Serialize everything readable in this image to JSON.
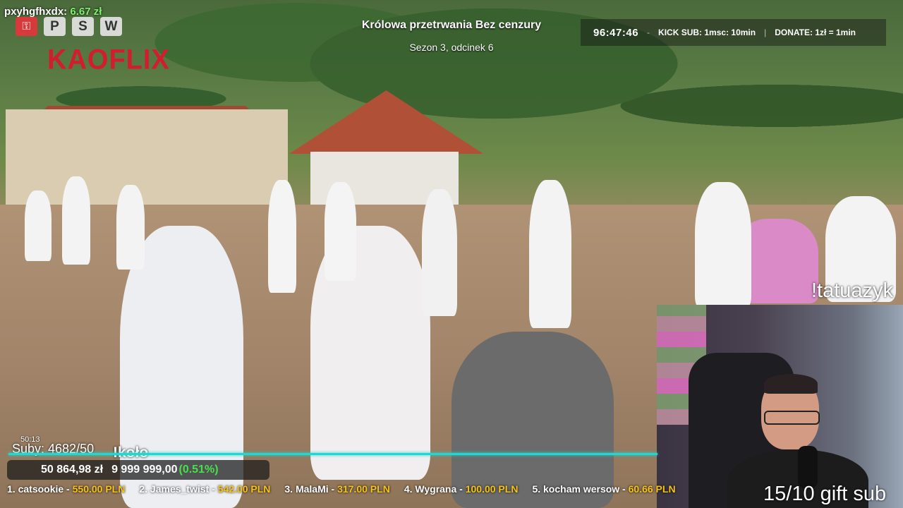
{
  "overlay": {
    "username": "pxyhgfhxdx:",
    "user_amount": "6.67 zł",
    "icons": [
      "key-icon",
      "P",
      "S",
      "W"
    ],
    "logo": "KAOFLIX",
    "show_title": "Królowa przetrwania Bez cenzury",
    "show_subtitle": "Sezon 3, odcinek 6",
    "timer": "96:47:46",
    "sep1": "-",
    "kick_sub": "KICK SUB: 1msc: 10min",
    "sep2": "|",
    "donate": "DONATE: 1zł = 1min",
    "command": "!tatuazyk",
    "gift_sub": "15/10 gift sub",
    "small_time": "50:13",
    "subs": "Suby: 4682/50",
    "kolo": "!koło",
    "goal_current": "50 864,98 zł",
    "goal_target": "9 999 999,00",
    "goal_percent": "(0.51%)",
    "goal_progress": 0.0051,
    "sub_progress": 1.0
  },
  "leaderboard": [
    {
      "rank": "1.",
      "name": "catsookie",
      "value": "550.00 PLN"
    },
    {
      "rank": "2.",
      "name": "James_twist",
      "value": "542.00 PLN"
    },
    {
      "rank": "3.",
      "name": "MalaMi",
      "value": "317.00 PLN"
    },
    {
      "rank": "4.",
      "name": "Wygrana",
      "value": "100.00 PLN"
    },
    {
      "rank": "5.",
      "name": "kocham wersow",
      "value": "60.66 PLN"
    }
  ],
  "colors": {
    "accent_cyan": "#1fd8d1",
    "money_green": "#7df06b",
    "percent_green": "#48e04a",
    "leader_gold": "#f5c218",
    "logo_red": "#d11d2d"
  }
}
